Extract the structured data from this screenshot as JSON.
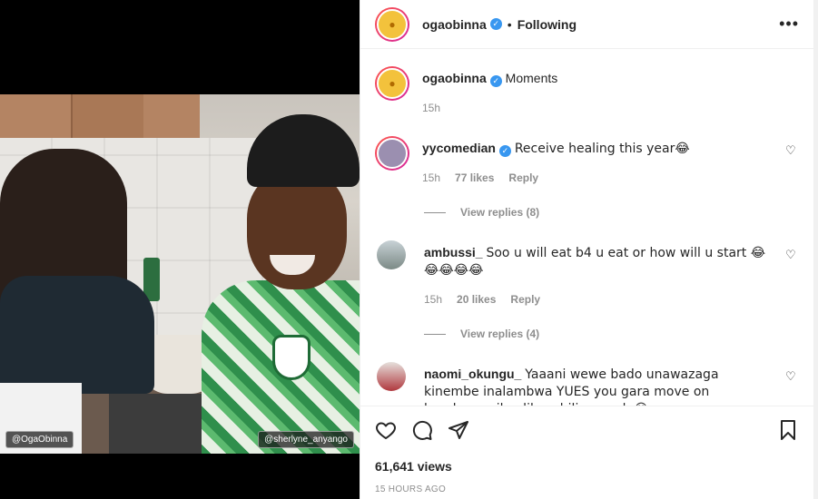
{
  "video": {
    "tag_left": "@OgaObinna",
    "tag_right": "@sherlyne_anyango"
  },
  "header": {
    "username": "ogaobinna",
    "separator": "•",
    "follow_status": "Following",
    "more": "•••"
  },
  "caption": {
    "username": "ogaobinna",
    "text": "Moments",
    "time": "15h"
  },
  "comments": [
    {
      "username": "yycomedian",
      "verified": true,
      "text": "Receive healing this year😂",
      "time": "15h",
      "likes": "77 likes",
      "reply": "Reply",
      "view_replies": "View replies (8)"
    },
    {
      "username": "ambussi_",
      "verified": false,
      "text": "Soo u will eat b4 u eat or how will u start 😂😂😂😂😂",
      "time": "15h",
      "likes": "20 likes",
      "reply": "Reply",
      "view_replies": "View replies (4)"
    },
    {
      "username": "naomi_okungu_",
      "verified": false,
      "text": "Yaaani wewe bado unawazaga kinembe inalambwa YUES you gara move on braah...navile alikuachilia pangla😂"
    }
  ],
  "footer": {
    "views": "61,641 views",
    "posted": "15 HOURS AGO"
  },
  "icons": {
    "like": "heart-icon",
    "comment": "comment-icon",
    "share": "share-icon",
    "save": "bookmark-icon"
  }
}
